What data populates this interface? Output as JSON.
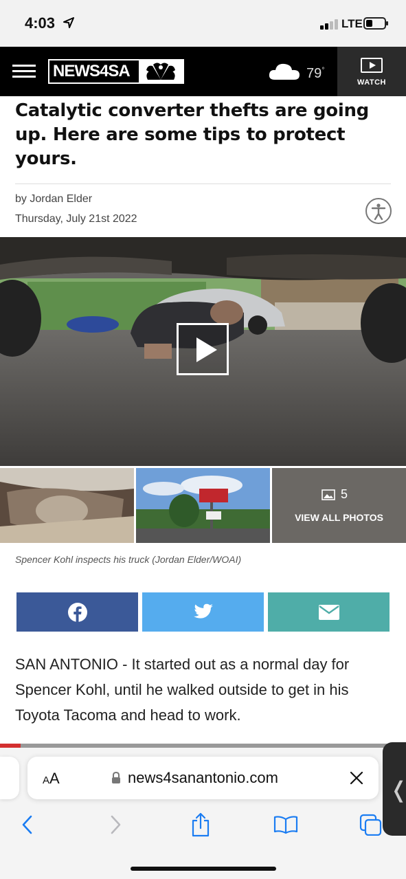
{
  "status_bar": {
    "time": "4:03",
    "network": "LTE"
  },
  "header": {
    "logo_text": "NEWS4SA",
    "temperature": "79",
    "degree": "°",
    "watch_label": "WATCH"
  },
  "article": {
    "headline": "Catalytic converter thefts are going up. Here are some tips to protect yours.",
    "byline": "by Jordan Elder",
    "date": "Thursday, July 21st 2022",
    "photo_count": "5",
    "view_all_label": "VIEW ALL PHOTOS",
    "caption": "Spencer Kohl inspects his truck (Jordan Elder/WOAI)",
    "body": "SAN ANTONIO - It started out as a normal day for Spencer Kohl, until he walked outside to get in his Toyota Tacoma and head to work.",
    "read_progress": 0.05
  },
  "share": [
    "facebook-icon",
    "twitter-icon",
    "email-icon"
  ],
  "browser": {
    "aa_small": "A",
    "aa_large": "A",
    "url": "news4sanantonio.com"
  },
  "colors": {
    "facebook": "#3b5998",
    "twitter": "#55acee",
    "email": "#4fada8",
    "progress": "#d32f2f",
    "ios_blue": "#1a7cf2"
  }
}
